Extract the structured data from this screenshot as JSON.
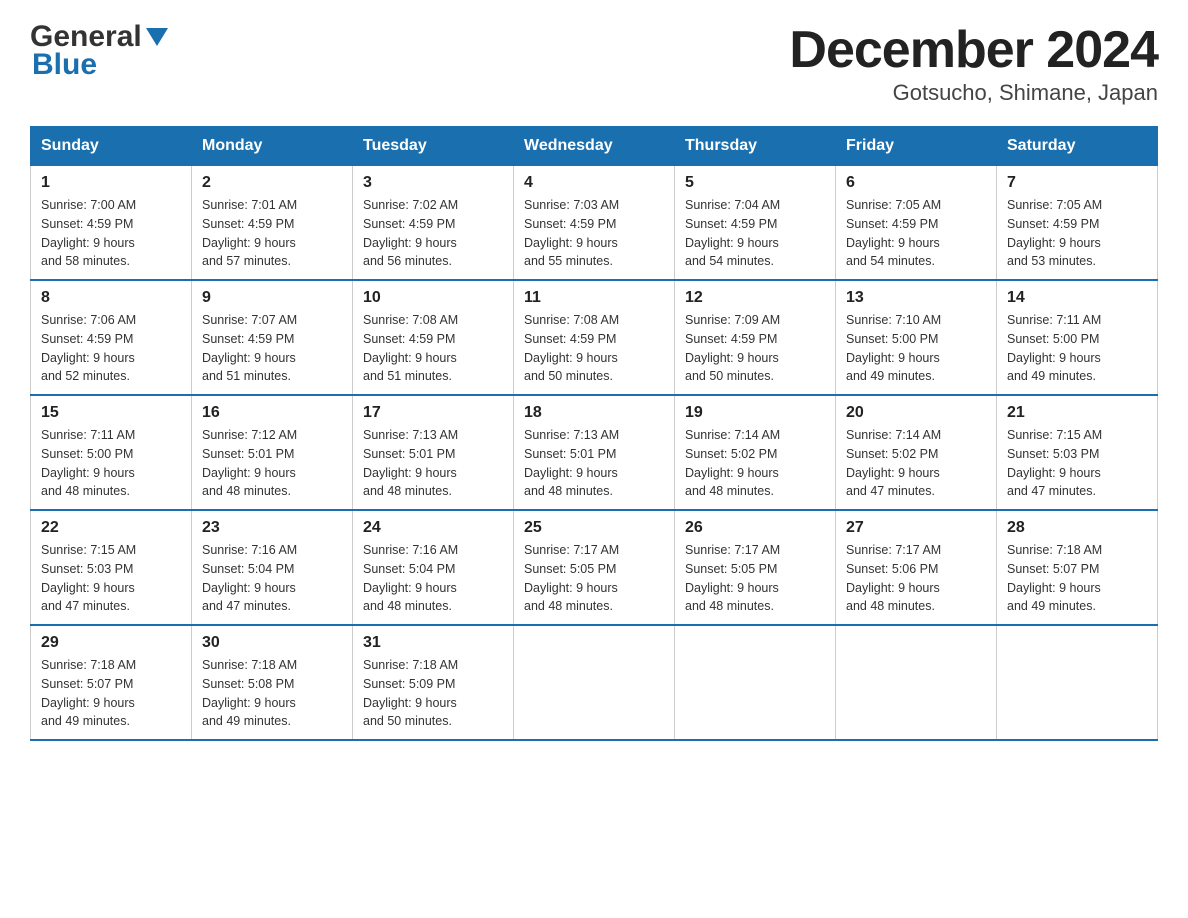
{
  "header": {
    "logo_general": "General",
    "logo_blue": "Blue",
    "title": "December 2024",
    "subtitle": "Gotsucho, Shimane, Japan"
  },
  "calendar": {
    "days_of_week": [
      "Sunday",
      "Monday",
      "Tuesday",
      "Wednesday",
      "Thursday",
      "Friday",
      "Saturday"
    ],
    "weeks": [
      [
        {
          "date": "1",
          "sunrise": "7:00 AM",
          "sunset": "4:59 PM",
          "daylight": "9 hours and 58 minutes."
        },
        {
          "date": "2",
          "sunrise": "7:01 AM",
          "sunset": "4:59 PM",
          "daylight": "9 hours and 57 minutes."
        },
        {
          "date": "3",
          "sunrise": "7:02 AM",
          "sunset": "4:59 PM",
          "daylight": "9 hours and 56 minutes."
        },
        {
          "date": "4",
          "sunrise": "7:03 AM",
          "sunset": "4:59 PM",
          "daylight": "9 hours and 55 minutes."
        },
        {
          "date": "5",
          "sunrise": "7:04 AM",
          "sunset": "4:59 PM",
          "daylight": "9 hours and 54 minutes."
        },
        {
          "date": "6",
          "sunrise": "7:05 AM",
          "sunset": "4:59 PM",
          "daylight": "9 hours and 54 minutes."
        },
        {
          "date": "7",
          "sunrise": "7:05 AM",
          "sunset": "4:59 PM",
          "daylight": "9 hours and 53 minutes."
        }
      ],
      [
        {
          "date": "8",
          "sunrise": "7:06 AM",
          "sunset": "4:59 PM",
          "daylight": "9 hours and 52 minutes."
        },
        {
          "date": "9",
          "sunrise": "7:07 AM",
          "sunset": "4:59 PM",
          "daylight": "9 hours and 51 minutes."
        },
        {
          "date": "10",
          "sunrise": "7:08 AM",
          "sunset": "4:59 PM",
          "daylight": "9 hours and 51 minutes."
        },
        {
          "date": "11",
          "sunrise": "7:08 AM",
          "sunset": "4:59 PM",
          "daylight": "9 hours and 50 minutes."
        },
        {
          "date": "12",
          "sunrise": "7:09 AM",
          "sunset": "4:59 PM",
          "daylight": "9 hours and 50 minutes."
        },
        {
          "date": "13",
          "sunrise": "7:10 AM",
          "sunset": "5:00 PM",
          "daylight": "9 hours and 49 minutes."
        },
        {
          "date": "14",
          "sunrise": "7:11 AM",
          "sunset": "5:00 PM",
          "daylight": "9 hours and 49 minutes."
        }
      ],
      [
        {
          "date": "15",
          "sunrise": "7:11 AM",
          "sunset": "5:00 PM",
          "daylight": "9 hours and 48 minutes."
        },
        {
          "date": "16",
          "sunrise": "7:12 AM",
          "sunset": "5:01 PM",
          "daylight": "9 hours and 48 minutes."
        },
        {
          "date": "17",
          "sunrise": "7:13 AM",
          "sunset": "5:01 PM",
          "daylight": "9 hours and 48 minutes."
        },
        {
          "date": "18",
          "sunrise": "7:13 AM",
          "sunset": "5:01 PM",
          "daylight": "9 hours and 48 minutes."
        },
        {
          "date": "19",
          "sunrise": "7:14 AM",
          "sunset": "5:02 PM",
          "daylight": "9 hours and 48 minutes."
        },
        {
          "date": "20",
          "sunrise": "7:14 AM",
          "sunset": "5:02 PM",
          "daylight": "9 hours and 47 minutes."
        },
        {
          "date": "21",
          "sunrise": "7:15 AM",
          "sunset": "5:03 PM",
          "daylight": "9 hours and 47 minutes."
        }
      ],
      [
        {
          "date": "22",
          "sunrise": "7:15 AM",
          "sunset": "5:03 PM",
          "daylight": "9 hours and 47 minutes."
        },
        {
          "date": "23",
          "sunrise": "7:16 AM",
          "sunset": "5:04 PM",
          "daylight": "9 hours and 47 minutes."
        },
        {
          "date": "24",
          "sunrise": "7:16 AM",
          "sunset": "5:04 PM",
          "daylight": "9 hours and 48 minutes."
        },
        {
          "date": "25",
          "sunrise": "7:17 AM",
          "sunset": "5:05 PM",
          "daylight": "9 hours and 48 minutes."
        },
        {
          "date": "26",
          "sunrise": "7:17 AM",
          "sunset": "5:05 PM",
          "daylight": "9 hours and 48 minutes."
        },
        {
          "date": "27",
          "sunrise": "7:17 AM",
          "sunset": "5:06 PM",
          "daylight": "9 hours and 48 minutes."
        },
        {
          "date": "28",
          "sunrise": "7:18 AM",
          "sunset": "5:07 PM",
          "daylight": "9 hours and 49 minutes."
        }
      ],
      [
        {
          "date": "29",
          "sunrise": "7:18 AM",
          "sunset": "5:07 PM",
          "daylight": "9 hours and 49 minutes."
        },
        {
          "date": "30",
          "sunrise": "7:18 AM",
          "sunset": "5:08 PM",
          "daylight": "9 hours and 49 minutes."
        },
        {
          "date": "31",
          "sunrise": "7:18 AM",
          "sunset": "5:09 PM",
          "daylight": "9 hours and 50 minutes."
        },
        null,
        null,
        null,
        null
      ]
    ],
    "labels": {
      "sunrise": "Sunrise:",
      "sunset": "Sunset:",
      "daylight": "Daylight:"
    }
  }
}
